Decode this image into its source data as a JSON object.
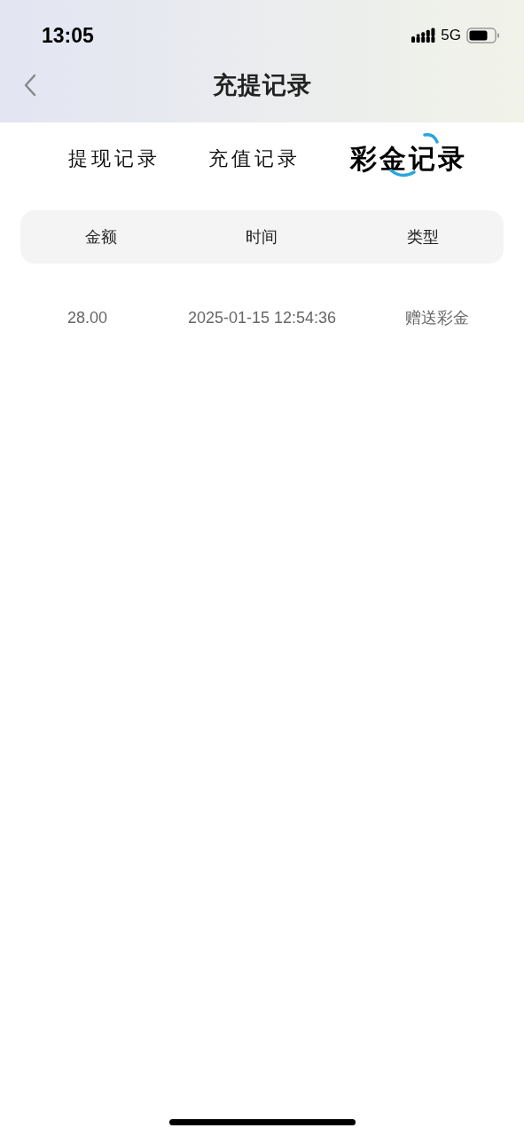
{
  "status_bar": {
    "time": "13:05",
    "network": "5G"
  },
  "header": {
    "title": "充提记录"
  },
  "tabs": [
    {
      "label": "提现记录",
      "selected": false
    },
    {
      "label": "充值记录",
      "selected": false
    },
    {
      "label": "彩金记录",
      "selected": true
    }
  ],
  "table": {
    "columns": [
      "金额",
      "时间",
      "类型"
    ],
    "rows": [
      [
        "28.00",
        "2025-01-15 12:54:36",
        "赠送彩金"
      ]
    ]
  }
}
